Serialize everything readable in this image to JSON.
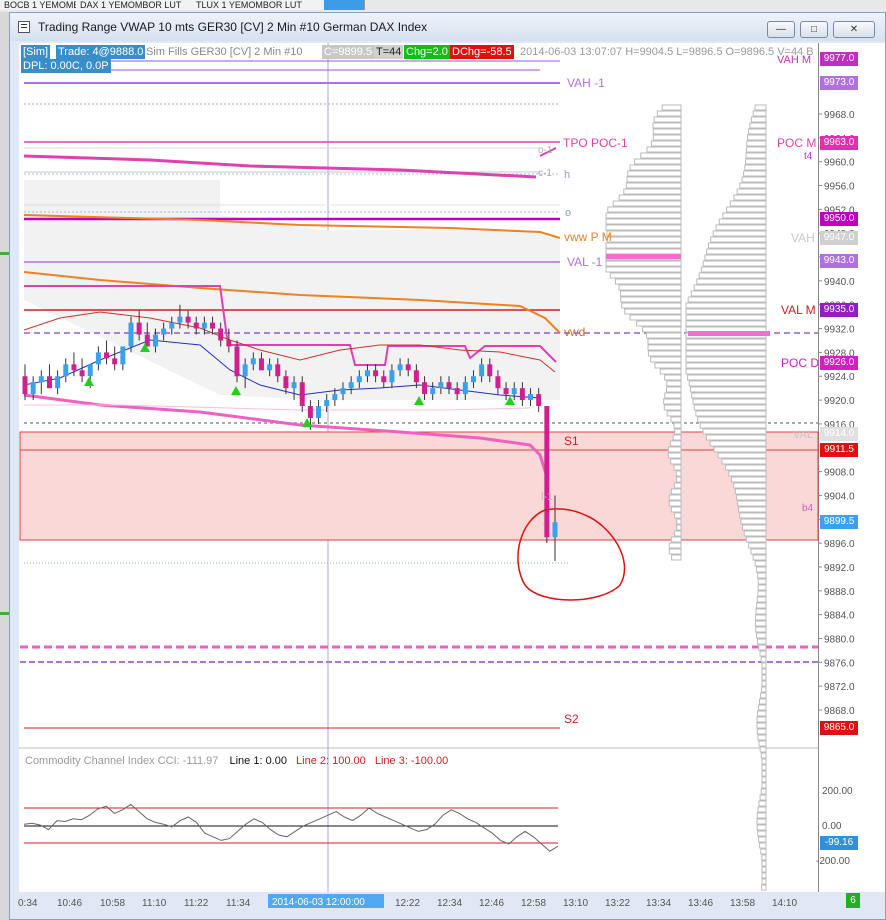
{
  "taskbar": {
    "tabs": [
      "BOCB 1 YEMOMBOR LUT",
      "DAX 1 YEMOMBOR LUT",
      "TLUX 1 YEMOMBOR LUT",
      ""
    ]
  },
  "window": {
    "title": "Trading Range VWAP 10 mts  GER30 [CV]  2 Min   #10  German DAX Index",
    "minimize": "—",
    "maximize": "□",
    "close": "✕"
  },
  "header": {
    "sim": "[Sim]",
    "trade": "Trade: 4@9888.0",
    "simfills": "Sim Fills  GER30 [CV]  2 Min   #10",
    "c_val": "C=9899.5",
    "t_val": "T=44",
    "chg": "Chg=2.0",
    "dchg": "DChg=-58.5",
    "ohlc": "2014-06-03 13:07:07 H=9904.5 L=9896.5 O=9896.5 V=44 B",
    "dpl": "DPL: 0.00C, 0.0P"
  },
  "chart_labels": {
    "vah1": "VAH -1",
    "tpo_poc1": "TPO POC-1",
    "o1": "o-1",
    "c1": "c-1",
    "h": "h",
    "o": "o",
    "vwwpm": "vww P M",
    "val1": "VAL -1",
    "vwd": "vwd",
    "s1": "S1",
    "l1": "l-1",
    "s2": "S2",
    "vah_m": "VAH M",
    "poc_m": "POC M",
    "t4": "t4",
    "vah": "VAH",
    "val_m": "VAL M",
    "poc_d": "POC D",
    "val": "VAL",
    "b4": "b4"
  },
  "price_tags": [
    {
      "text": "9977.0",
      "color": "#c030c0"
    },
    {
      "text": "9973.0",
      "color": "#b070e0"
    },
    {
      "text": "9963.0",
      "color": "#e030b0"
    },
    {
      "text": "9950.0",
      "color": "#c000c0"
    },
    {
      "text": "9947.0",
      "color": "#d0d0d0"
    },
    {
      "text": "9943.0",
      "color": "#b070e0"
    },
    {
      "text": "9935.0",
      "color": "#9020c0"
    },
    {
      "text": "9926.0",
      "color": "#d020c0"
    },
    {
      "text": "9914.0",
      "color": "#e0e0e0"
    },
    {
      "text": "9911.5",
      "color": "#e01010"
    },
    {
      "text": "9899.5",
      "color": "#40a0f0"
    },
    {
      "text": "9865.0",
      "color": "#e01010"
    },
    {
      "text": "-99.16",
      "color": "#3090e0"
    }
  ],
  "indicator": {
    "title": "Commodity Channel Index  CCI: -111.97",
    "line1": "Line 1: 0.00",
    "line2": "Line 2: 100.00",
    "line3": "Line 3: -100.00",
    "ticks": [
      "200.00",
      "0.00",
      "-200.00"
    ]
  },
  "time_axis": {
    "labels": [
      "0:34",
      "10:46",
      "10:58",
      "11:10",
      "11:22",
      "11:34",
      "12:00",
      "12:22",
      "12:34",
      "12:46",
      "12:58",
      "13:10",
      "13:22",
      "13:34",
      "13:46",
      "13:58",
      "14:10"
    ],
    "cursor": "2014-06-03  12:00:00"
  },
  "status": {
    "count": "6"
  },
  "chart_data": {
    "type": "candlestick",
    "title": "Trading Range VWAP 10 mts  GER30 [CV]  2 Min   #10  German DAX Index",
    "ylim": [
      9860,
      9980
    ],
    "yticks": [
      9968,
      9964,
      9960,
      9956,
      9952,
      9948,
      9944,
      9940,
      9936,
      9932,
      9928,
      9924,
      9920,
      9916,
      9908,
      9904,
      9900,
      9896,
      9892,
      9888,
      9884,
      9880,
      9876,
      9872,
      9868
    ],
    "candles": [
      [
        9924,
        9926,
        9920,
        9921
      ],
      [
        9921,
        9924,
        9920,
        9923
      ],
      [
        9923,
        9925,
        9921,
        9924
      ],
      [
        9924,
        9926,
        9922,
        9922
      ],
      [
        9922,
        9925,
        9921,
        9924
      ],
      [
        9924,
        9927,
        9923,
        9926
      ],
      [
        9926,
        9928,
        9924,
        9925
      ],
      [
        9925,
        9927,
        9923,
        9924
      ],
      [
        9924,
        9926,
        9922,
        9926
      ],
      [
        9926,
        9929,
        9925,
        9928
      ],
      [
        9928,
        9930,
        9926,
        9927
      ],
      [
        9927,
        9929,
        9925,
        9926
      ],
      [
        9926,
        9929,
        9925,
        9929
      ],
      [
        9929,
        9934,
        9928,
        9933
      ],
      [
        9933,
        9935,
        9930,
        9931
      ],
      [
        9931,
        9933,
        9929,
        9929
      ],
      [
        9929,
        9932,
        9928,
        9931
      ],
      [
        9931,
        9933,
        9930,
        9932
      ],
      [
        9932,
        9934,
        9931,
        9933
      ],
      [
        9933,
        9936,
        9932,
        9934
      ],
      [
        9934,
        9935,
        9932,
        9933
      ],
      [
        9933,
        9934,
        9931,
        9932
      ],
      [
        9932,
        9934,
        9931,
        9933
      ],
      [
        9933,
        9934,
        9931,
        9932
      ],
      [
        9932,
        9933,
        9929,
        9930
      ],
      [
        9930,
        9932,
        9928,
        9929
      ],
      [
        9929,
        9930,
        9923,
        9924
      ],
      [
        9924,
        9927,
        9922,
        9926
      ],
      [
        9926,
        9928,
        9925,
        9927
      ],
      [
        9927,
        9928,
        9925,
        9925
      ],
      [
        9925,
        9927,
        9924,
        9926
      ],
      [
        9926,
        9927,
        9923,
        9924
      ],
      [
        9924,
        9925,
        9921,
        9922
      ],
      [
        9922,
        9924,
        9920,
        9923
      ],
      [
        9923,
        9924,
        9918,
        9919
      ],
      [
        9919,
        9920,
        9915,
        9917
      ],
      [
        9917,
        9920,
        9916,
        9919
      ],
      [
        9919,
        9921,
        9918,
        9920
      ],
      [
        9920,
        9922,
        9919,
        9921
      ],
      [
        9921,
        9923,
        9920,
        9922
      ],
      [
        9922,
        9924,
        9921,
        9923
      ],
      [
        9923,
        9925,
        9922,
        9924
      ],
      [
        9924,
        9926,
        9923,
        9925
      ],
      [
        9925,
        9926,
        9923,
        9924
      ],
      [
        9924,
        9925,
        9922,
        9923
      ],
      [
        9923,
        9926,
        9922,
        9925
      ],
      [
        9925,
        9927,
        9924,
        9926
      ],
      [
        9926,
        9927,
        9924,
        9925
      ],
      [
        9925,
        9926,
        9922,
        9923
      ],
      [
        9923,
        9924,
        9920,
        9921
      ],
      [
        9921,
        9923,
        9920,
        9922
      ],
      [
        9922,
        9924,
        9921,
        9923
      ],
      [
        9923,
        9924,
        9921,
        9922
      ],
      [
        9922,
        9923,
        9920,
        9921
      ],
      [
        9921,
        9924,
        9920,
        9923
      ],
      [
        9923,
        9925,
        9922,
        9924
      ],
      [
        9924,
        9927,
        9923,
        9926
      ],
      [
        9926,
        9927,
        9923,
        9924
      ],
      [
        9924,
        9925,
        9921,
        9922
      ],
      [
        9922,
        9923,
        9920,
        9921
      ],
      [
        9921,
        9923,
        9920,
        9922
      ],
      [
        9922,
        9923,
        9919,
        9920
      ],
      [
        9920,
        9922,
        9919,
        9921
      ],
      [
        9921,
        9922,
        9918,
        9919
      ],
      [
        9919,
        9919,
        9896,
        9897
      ],
      [
        9897,
        9904,
        9893,
        9899.5
      ]
    ],
    "cci": [
      10,
      15,
      5,
      -20,
      30,
      25,
      40,
      35,
      60,
      95,
      110,
      70,
      90,
      120,
      80,
      40,
      20,
      10,
      -5,
      30,
      50,
      20,
      -40,
      -60,
      -80,
      -70,
      -30,
      10,
      40,
      20,
      -20,
      -50,
      -60,
      -30,
      0,
      20,
      40,
      60,
      80,
      50,
      30,
      60,
      100,
      70,
      50,
      30,
      10,
      -10,
      -30,
      -20,
      10,
      60,
      90,
      70,
      40,
      20,
      -10,
      -40,
      -80,
      -100,
      -60,
      -30,
      -60,
      -100,
      -140,
      -111.97
    ]
  }
}
